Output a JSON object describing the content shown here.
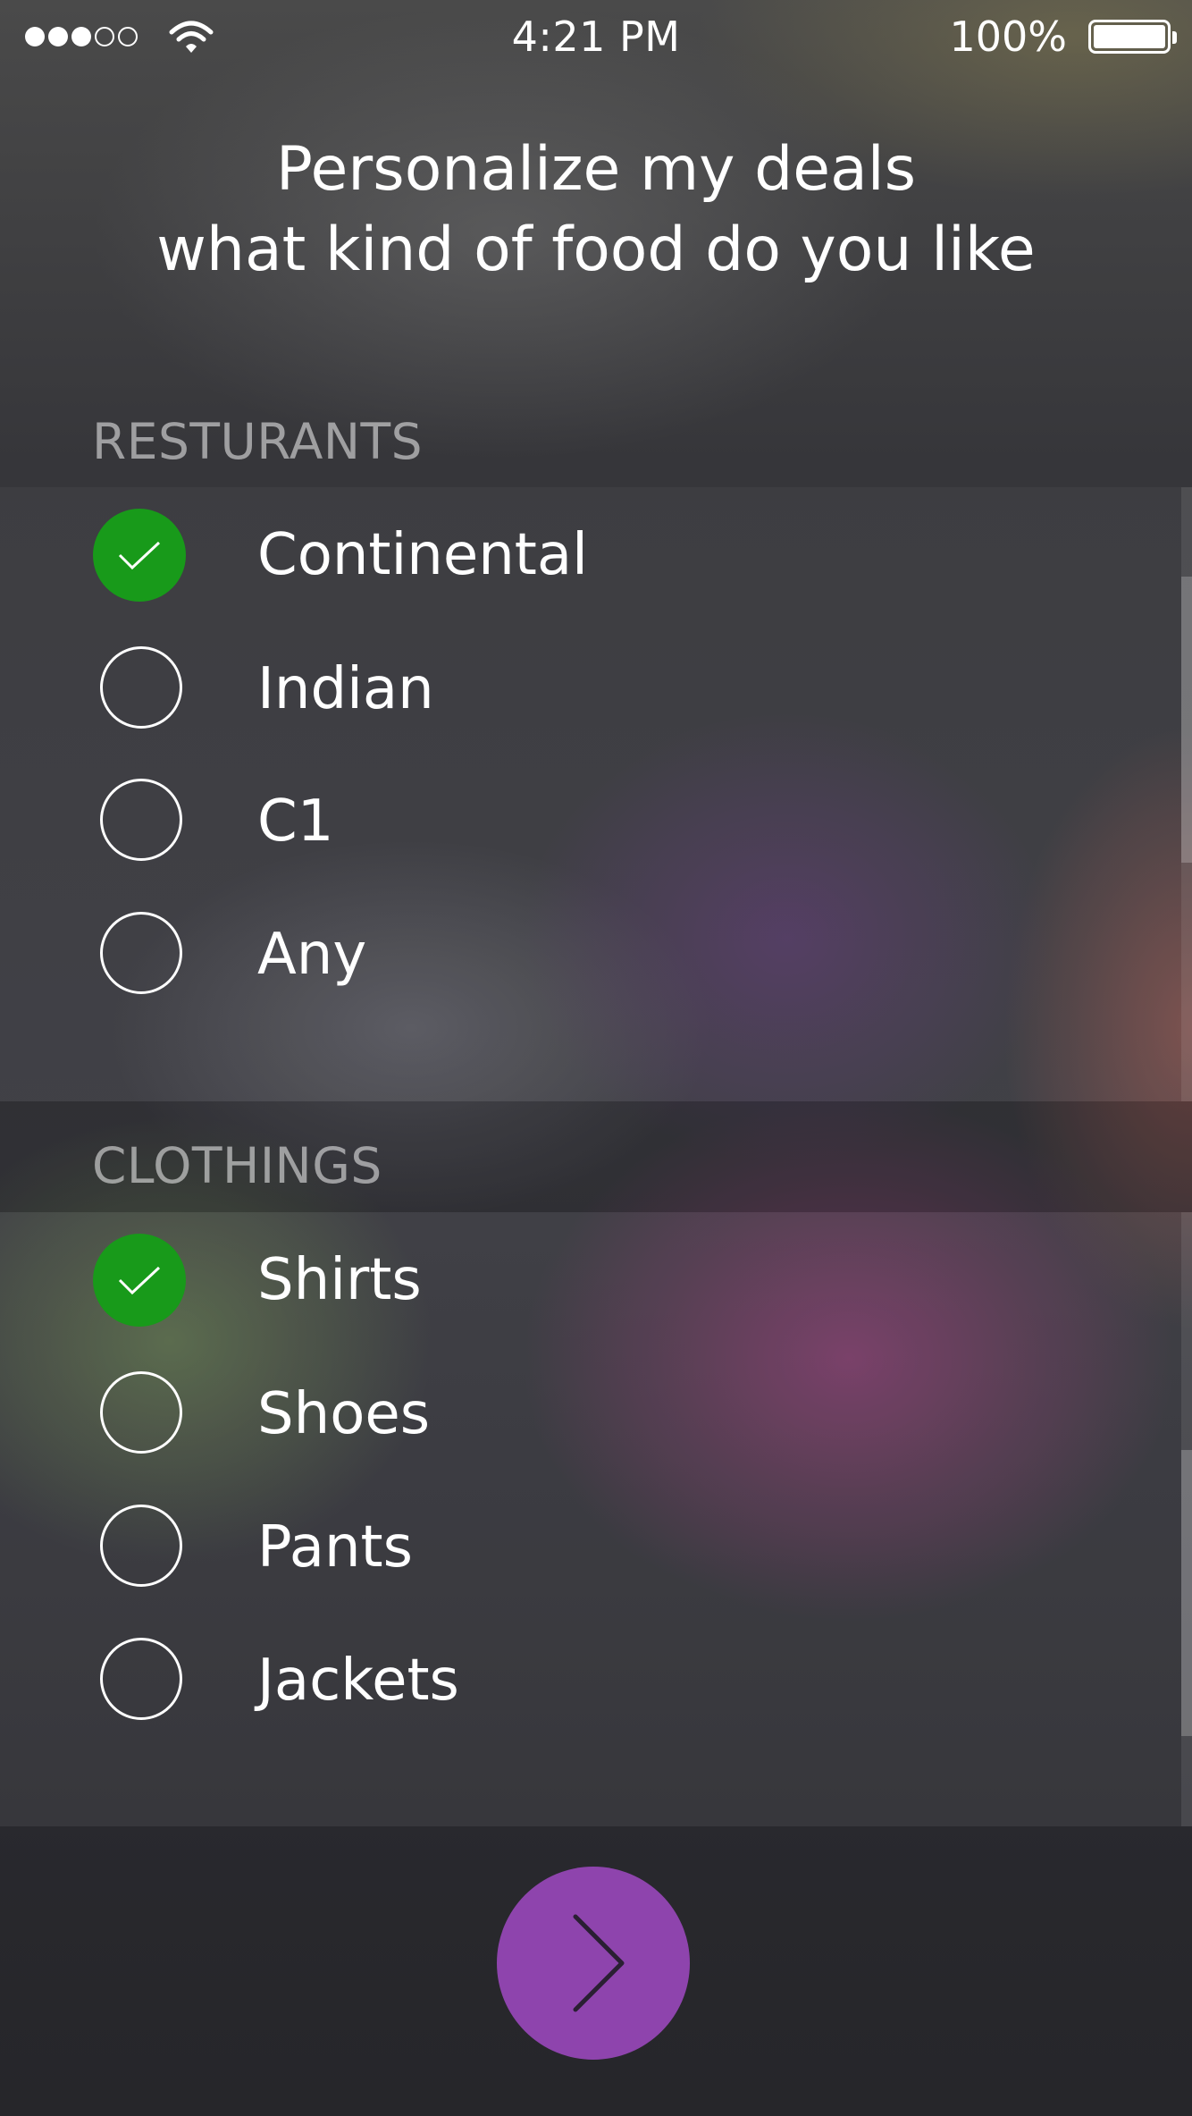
{
  "status_bar": {
    "time": "4:21 PM",
    "battery_percent": "100%",
    "signal_strength": 3,
    "signal_max": 5,
    "icons": [
      "signal-dots-icon",
      "wifi-icon",
      "battery-icon"
    ]
  },
  "heading": {
    "line1": "Personalize my deals",
    "line2": "what kind of food do you like"
  },
  "sections": [
    {
      "title": "RESTURANTS",
      "options": [
        {
          "label": "Continental",
          "checked": true
        },
        {
          "label": "Indian",
          "checked": false
        },
        {
          "label": "C1",
          "checked": false
        },
        {
          "label": "Any",
          "checked": false
        }
      ]
    },
    {
      "title": "CLOTHINGS",
      "options": [
        {
          "label": "Shirts",
          "checked": true
        },
        {
          "label": "Shoes",
          "checked": false
        },
        {
          "label": "Pants",
          "checked": false
        },
        {
          "label": "Jackets",
          "checked": false
        }
      ]
    }
  ],
  "next_button": {
    "icon": "chevron-right-icon"
  },
  "colors": {
    "checked": "#189a1a",
    "accent": "#8e44ad",
    "text": "#ffffff",
    "section_label": "#9a9a9a"
  }
}
